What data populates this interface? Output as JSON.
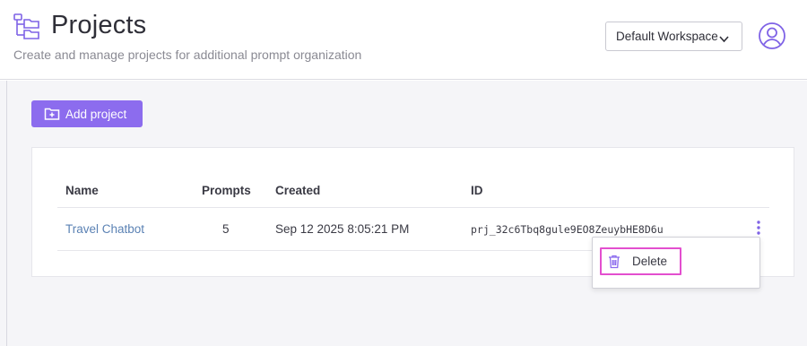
{
  "header": {
    "title": "Projects",
    "subtitle": "Create and manage projects for additional prompt organization",
    "title_icon": "folder-tree-icon",
    "workspace_select": {
      "selected": "Default Workspace"
    },
    "avatar_icon": "user-circle-icon"
  },
  "toolbar": {
    "add_project_label": "Add project",
    "add_project_icon": "folder-plus-icon"
  },
  "table": {
    "columns": [
      "Name",
      "Prompts",
      "Created",
      "ID"
    ],
    "rows": [
      {
        "name": "Travel Chatbot",
        "prompts": "5",
        "created": "Sep 12 2025 8:05:21 PM",
        "id": "prj_32c6Tbq8gule9EO8ZeuybHE8D6u"
      }
    ]
  },
  "context_menu": {
    "items": [
      {
        "label": "Delete",
        "icon": "trash-icon"
      }
    ]
  },
  "colors": {
    "accent": "#8c6cee",
    "link": "#5b82b4",
    "highlight": "#e34fcf",
    "background": "#f5f5f8"
  }
}
